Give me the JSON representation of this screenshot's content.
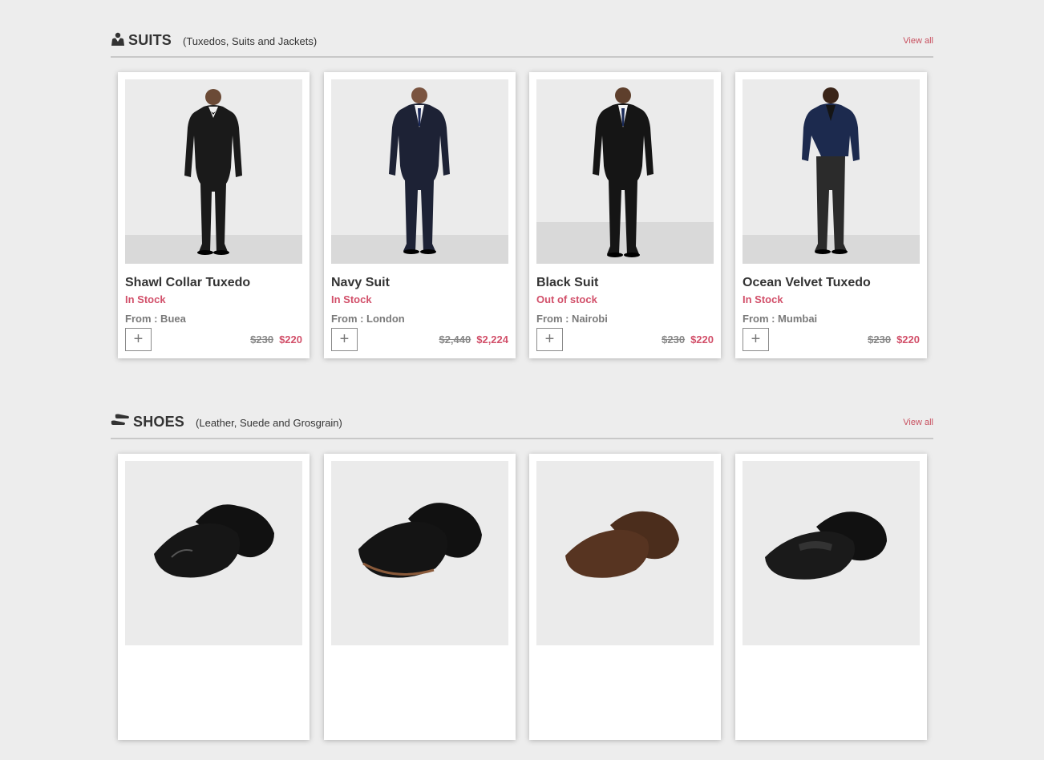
{
  "sections": [
    {
      "icon": "suit-icon",
      "title": "SUITS",
      "subtitle": "(Tuxedos, Suits and Jackets)",
      "view_all": "View all",
      "products": [
        {
          "name": "Shawl Collar Tuxedo",
          "stock": "In Stock",
          "from": "From : Buea",
          "old_price": "$230",
          "price": "$220",
          "image": "man-black-tuxedo-photo"
        },
        {
          "name": "Navy Suit",
          "stock": "In Stock",
          "from": "From : London",
          "old_price": "$2,440",
          "price": "$2,224",
          "image": "man-navy-suit-photo"
        },
        {
          "name": "Black Suit",
          "stock": "Out of stock",
          "from": "From : Nairobi",
          "old_price": "$230",
          "price": "$220",
          "image": "man-black-suit-photo"
        },
        {
          "name": "Ocean Velvet Tuxedo",
          "stock": "In Stock",
          "from": "From : Mumbai",
          "old_price": "$230",
          "price": "$220",
          "image": "man-velvet-tuxedo-photo"
        }
      ]
    },
    {
      "icon": "shoe-icon",
      "title": "SHOES",
      "subtitle": "(Leather, Suede and Grosgrain)",
      "view_all": "View all",
      "products": [
        {
          "image": "black-cap-toe-oxford-photo"
        },
        {
          "image": "black-derby-shoe-photo"
        },
        {
          "image": "brown-suede-derby-photo"
        },
        {
          "image": "black-velvet-loafer-photo"
        }
      ]
    }
  ],
  "colors": {
    "background": "#ededed",
    "accent": "#d2506a",
    "old_price": "#888888"
  }
}
